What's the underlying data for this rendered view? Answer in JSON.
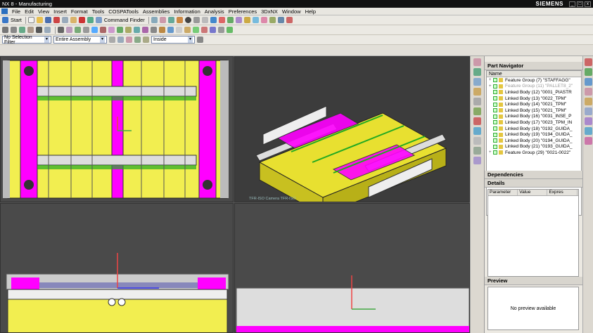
{
  "titlebar": {
    "title": "NX 8 - Manufacturing",
    "brand": "SIEMENS"
  },
  "menu": [
    "File",
    "Edit",
    "View",
    "Insert",
    "Format",
    "Tools",
    "COSPATools",
    "Assemblies",
    "Information",
    "Analysis",
    "Preferences",
    "3DxNX",
    "Window",
    "Help"
  ],
  "toolbar1": {
    "start_label": "Start",
    "command_finder_label": "Command Finder"
  },
  "toolbar3": {
    "selection_filter": "No Selection Filter",
    "scope": "Entire Assembly",
    "inside": "Inside"
  },
  "viewports": {
    "iso_label": "TFR-ISO Camera TFR-ISO"
  },
  "part_navigator": {
    "title": "Part Navigator",
    "col_name": "Name",
    "rows": [
      {
        "label": "Feature Group (7) \"STAFFAGG\"",
        "muted": false,
        "expand": "+"
      },
      {
        "label": "Feature Group (11) \"PALLET8_2\"",
        "muted": true,
        "expand": "+"
      },
      {
        "label": "Linked Body (12) \"0001_PIASTR",
        "muted": false,
        "expand": ""
      },
      {
        "label": "Linked Body (13) \"0022_TPM\"",
        "muted": false,
        "expand": ""
      },
      {
        "label": "Linked Body (14) \"0021_TPM\"",
        "muted": false,
        "expand": ""
      },
      {
        "label": "Linked Body (15) \"0021_TPM\"",
        "muted": false,
        "expand": ""
      },
      {
        "label": "Linked Body (16) \"0031_INSE_P",
        "muted": false,
        "expand": ""
      },
      {
        "label": "Linked Body (17) \"0023_TPM_IN",
        "muted": false,
        "expand": ""
      },
      {
        "label": "Linked Body (18) \"0192_GUIDA_",
        "muted": false,
        "expand": ""
      },
      {
        "label": "Linked Body (19) \"0194_GUIDA_",
        "muted": false,
        "expand": ""
      },
      {
        "label": "Linked Body (20) \"0194_GUIDA_",
        "muted": false,
        "expand": ""
      },
      {
        "label": "Linked Body (21) \"0193_GUIDA_",
        "muted": false,
        "expand": ""
      },
      {
        "label": "Feature Group (29) \"0021-0022\"",
        "muted": false,
        "expand": "+"
      }
    ],
    "dependencies_title": "Dependencies",
    "details_title": "Details",
    "details_cols": [
      "Parameter",
      "Value",
      "Expres"
    ],
    "preview_title": "Preview",
    "preview_text": "No preview available"
  },
  "colors": {
    "magenta": "#ff00ff",
    "yellow": "#f2ee50",
    "bg_dark": "#4a4a4a"
  }
}
